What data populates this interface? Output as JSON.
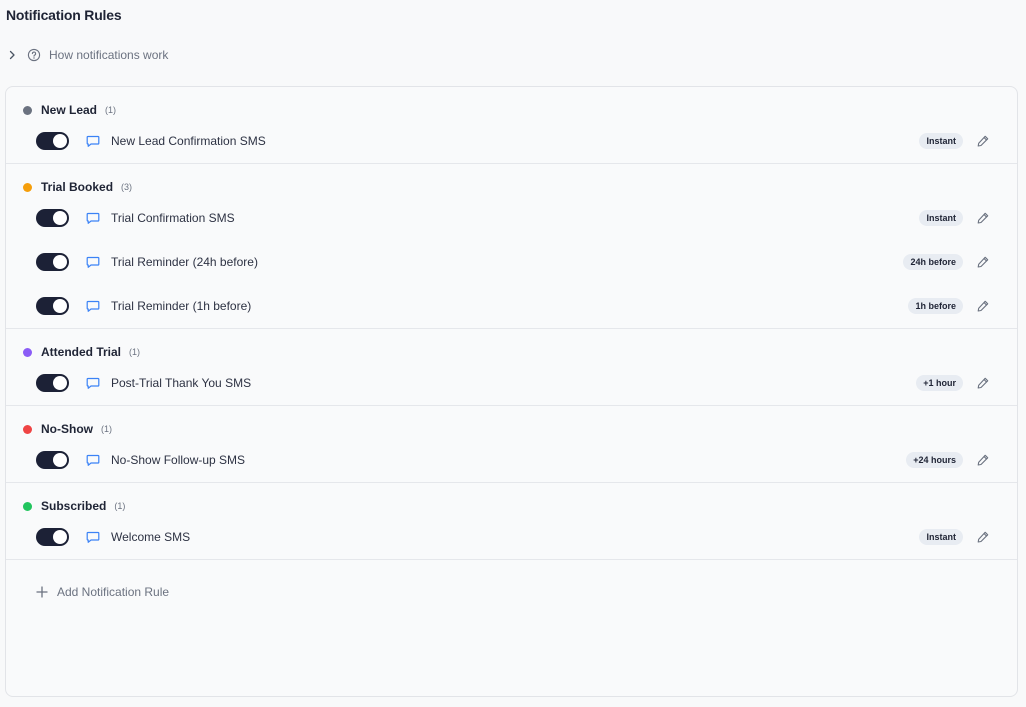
{
  "page": {
    "title": "Notification Rules",
    "how_label": "How notifications work",
    "add_label": "Add Notification Rule"
  },
  "colors": {
    "toggle_on": "#1c2136",
    "message_icon": "#3b82f6",
    "badge_bg": "#e8ecf2"
  },
  "groups": [
    {
      "title": "New Lead",
      "count": "(1)",
      "color": "#6b7280",
      "rules": [
        {
          "name": "New Lead Confirmation SMS",
          "timing": "Instant",
          "enabled": true
        }
      ]
    },
    {
      "title": "Trial Booked",
      "count": "(3)",
      "color": "#f59e0b",
      "rules": [
        {
          "name": "Trial Confirmation SMS",
          "timing": "Instant",
          "enabled": true
        },
        {
          "name": "Trial Reminder (24h before)",
          "timing": "24h before",
          "enabled": true
        },
        {
          "name": "Trial Reminder (1h before)",
          "timing": "1h before",
          "enabled": true
        }
      ]
    },
    {
      "title": "Attended Trial",
      "count": "(1)",
      "color": "#8b5cf6",
      "rules": [
        {
          "name": "Post-Trial Thank You SMS",
          "timing": "+1 hour",
          "enabled": true
        }
      ]
    },
    {
      "title": "No-Show",
      "count": "(1)",
      "color": "#ef4444",
      "rules": [
        {
          "name": "No-Show Follow-up SMS",
          "timing": "+24 hours",
          "enabled": true
        }
      ]
    },
    {
      "title": "Subscribed",
      "count": "(1)",
      "color": "#22c55e",
      "rules": [
        {
          "name": "Welcome SMS",
          "timing": "Instant",
          "enabled": true
        }
      ]
    }
  ]
}
